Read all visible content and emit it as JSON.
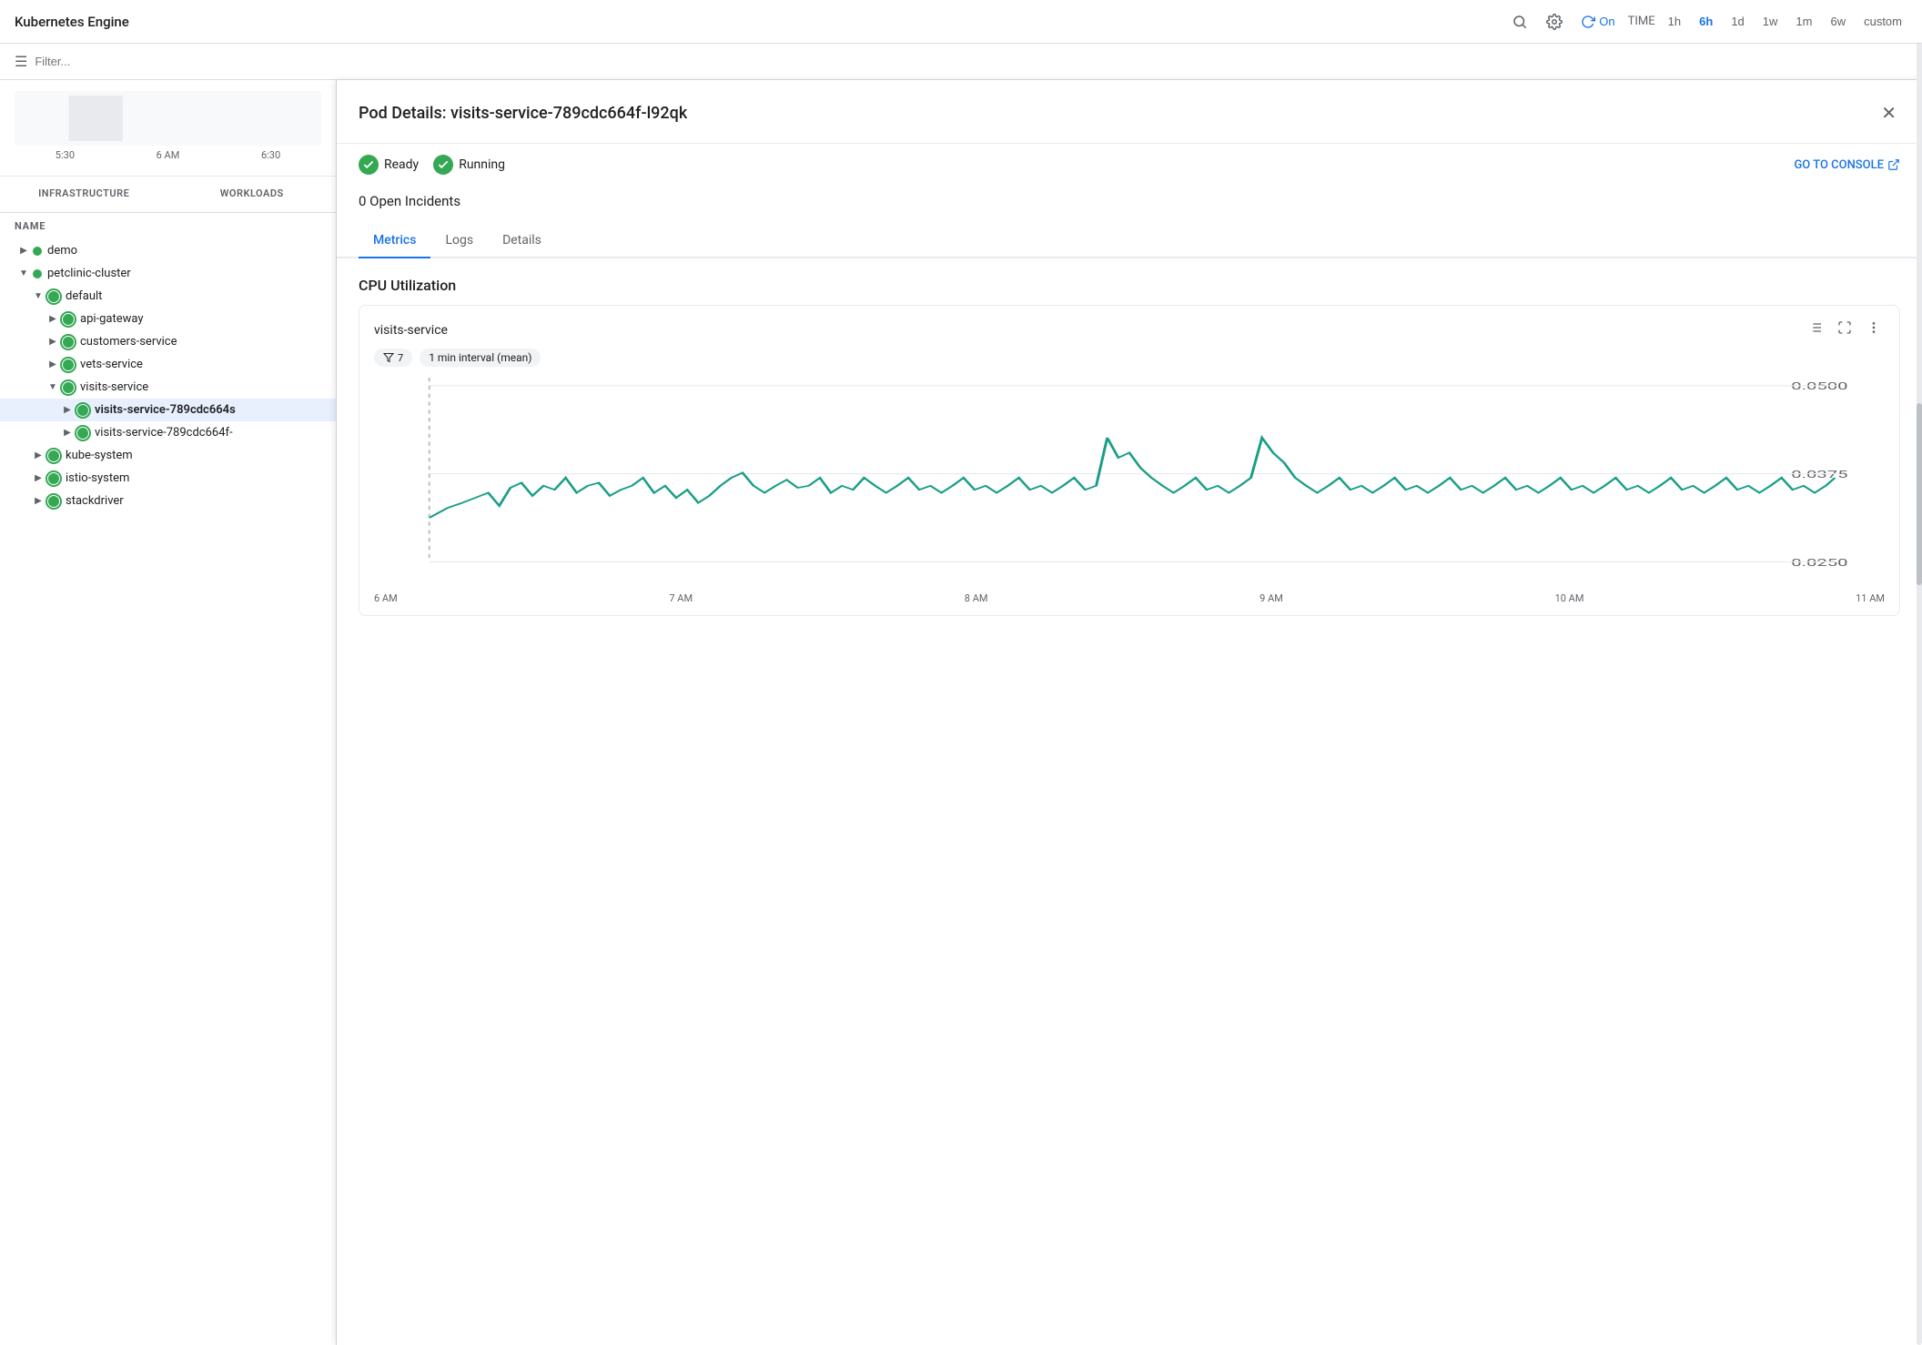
{
  "topbar": {
    "title": "Kubernetes Engine",
    "refresh_label": "On",
    "time_label": "TIME",
    "time_options": [
      "1h",
      "6h",
      "1d",
      "1w",
      "1m",
      "6w",
      "custom"
    ],
    "active_time": "6h"
  },
  "filterbar": {
    "placeholder": "Filter..."
  },
  "left_panel": {
    "tabs": [
      "INFRASTRUCTURE",
      "WORKLOADS"
    ],
    "column_header": "NAME",
    "tree": [
      {
        "id": "demo",
        "label": "demo",
        "level": 0,
        "expanded": false,
        "status": "green"
      },
      {
        "id": "petclinic-cluster",
        "label": "petclinic-cluster",
        "level": 0,
        "expanded": true,
        "status": "green"
      },
      {
        "id": "default",
        "label": "default",
        "level": 1,
        "expanded": true,
        "status": "green-ring"
      },
      {
        "id": "api-gateway",
        "label": "api-gateway",
        "level": 2,
        "expanded": false,
        "status": "green-ring"
      },
      {
        "id": "customers-service",
        "label": "customers-service",
        "level": 2,
        "expanded": false,
        "status": "green-ring"
      },
      {
        "id": "vets-service",
        "label": "vets-service",
        "level": 2,
        "expanded": false,
        "status": "green-ring"
      },
      {
        "id": "visits-service",
        "label": "visits-service",
        "level": 2,
        "expanded": true,
        "status": "green-ring"
      },
      {
        "id": "visits-pod-1",
        "label": "visits-service-789cdc664s",
        "level": 3,
        "expanded": false,
        "status": "green-ring",
        "bold": true
      },
      {
        "id": "visits-pod-2",
        "label": "visits-service-789cdc664f-",
        "level": 3,
        "expanded": false,
        "status": "green-ring"
      },
      {
        "id": "kube-system",
        "label": "kube-system",
        "level": 1,
        "expanded": false,
        "status": "green-ring"
      },
      {
        "id": "istio-system",
        "label": "istio-system",
        "level": 1,
        "expanded": false,
        "status": "green-ring"
      },
      {
        "id": "stackdriver",
        "label": "stackdriver",
        "level": 1,
        "expanded": false,
        "status": "green-ring"
      }
    ],
    "mini_chart_times": [
      "5:30",
      "6 AM",
      "6:30"
    ]
  },
  "pod_details": {
    "title": "Pod Details: visits-service-789cdc664f-l92qk",
    "status_ready": "Ready",
    "status_running": "Running",
    "console_link": "GO TO CONSOLE",
    "incidents": "0 Open Incidents",
    "tabs": [
      "Metrics",
      "Logs",
      "Details"
    ],
    "active_tab": "Metrics",
    "cpu_section_title": "CPU Utilization",
    "chart": {
      "title": "visits-service",
      "filter_count": "7",
      "interval_label": "1 min interval (mean)",
      "y_labels": [
        "0.0500",
        "0.0375",
        "0.0250"
      ],
      "x_labels": [
        "6 AM",
        "7 AM",
        "8 AM",
        "9 AM",
        "10 AM",
        "11 AM"
      ]
    }
  }
}
